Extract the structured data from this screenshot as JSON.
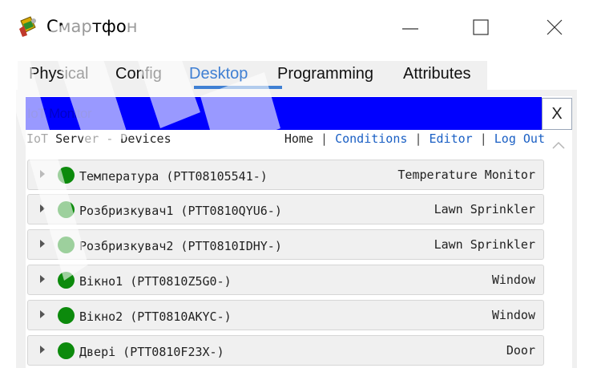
{
  "window": {
    "title": "Смартфон",
    "icon": "smartphone-app-icon",
    "controls": [
      "minimize-icon",
      "maximize-icon",
      "close-icon"
    ]
  },
  "tabs": [
    {
      "label": "Physical",
      "active": false
    },
    {
      "label": "Config",
      "active": false
    },
    {
      "label": "Desktop",
      "active": true
    },
    {
      "label": "Programming",
      "active": false
    },
    {
      "label": "Attributes",
      "active": false
    }
  ],
  "iot": {
    "title": "IoT Monitor",
    "close_label": "X",
    "server_label": "IoT Server - Devices",
    "nav": {
      "home": "Home",
      "conditions": "Conditions",
      "editor": "Editor",
      "logout": "Log Out",
      "separator": "|"
    }
  },
  "devices": [
    {
      "name": "Температура (PTT08105541-)",
      "type": "Temperature Monitor",
      "status_color": "#0c8a0c"
    },
    {
      "name": "Розбризкувач1 (PTT0810QYU6-)",
      "type": "Lawn Sprinkler",
      "status_color": "#0c8a0c"
    },
    {
      "name": "Розбризкувач2 (PTT0810IDHY-)",
      "type": "Lawn Sprinkler",
      "status_color": "#0c8a0c"
    },
    {
      "name": "Вікно1 (PTT0810Z5G0-)",
      "type": "Window",
      "status_color": "#0c8a0c"
    },
    {
      "name": "Вікно2 (PTT0810AKYC-)",
      "type": "Window",
      "status_color": "#0c8a0c"
    },
    {
      "name": "Двері (PTT0810F23X-)",
      "type": "Door",
      "status_color": "#0c8a0c"
    }
  ],
  "colors": {
    "accent": "#3f7fd3",
    "header_bg": "#0000ff",
    "link": "#1a5fc4",
    "status_on": "#0c8a0c"
  }
}
